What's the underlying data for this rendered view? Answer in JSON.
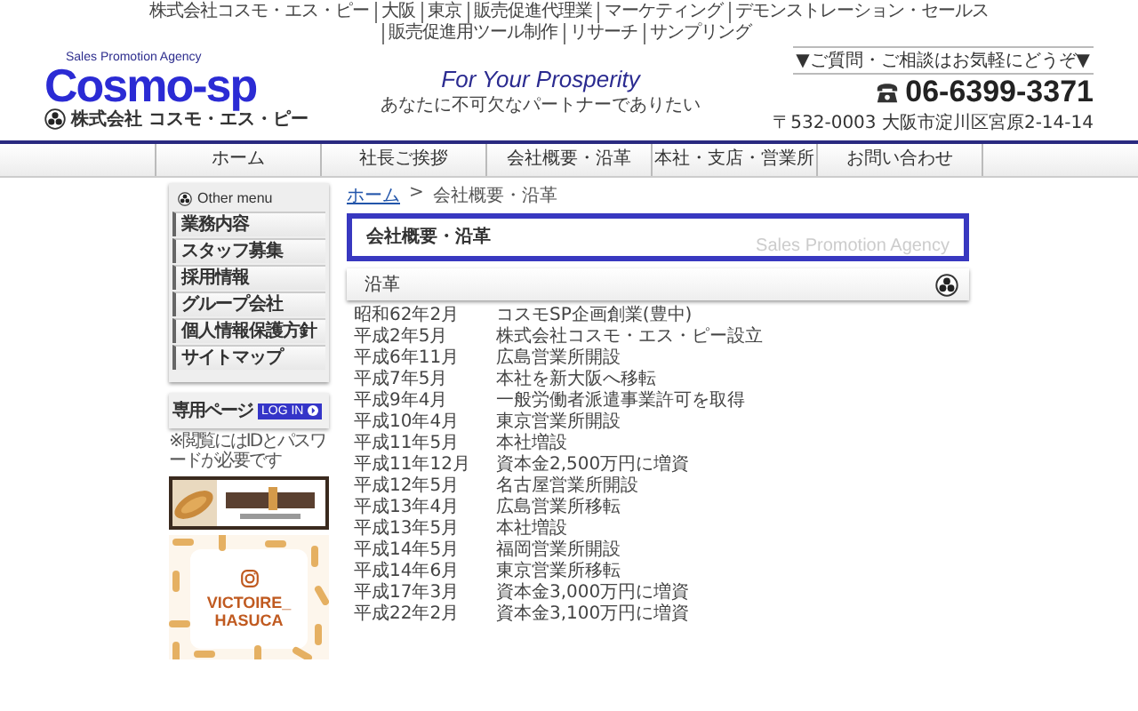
{
  "top_links": [
    "株式会社コスモ・エス・ピー",
    "大阪",
    "東京",
    "販売促進代理業",
    "マーケティング",
    "デモンストレーション・セールス",
    "販売促進用ツール制作",
    "リサーチ",
    "サンプリング"
  ],
  "logo": {
    "tagline": "Sales Promotion Agency",
    "name": "Cosmo-sp",
    "company": "株式会社 コスモ・エス・ピー"
  },
  "slogan": {
    "title": "For Your Prosperity",
    "subtitle": "あなたに不可欠なパートナーでありたい"
  },
  "contact": {
    "note": "▼ご質問・ご相談はお気軽にどうぞ▼",
    "phone": "06-6399-3371",
    "address": "〒532-0003 大阪市淀川区宮原2-14-14"
  },
  "nav": [
    "ホーム",
    "社長ご挨拶",
    "会社概要・沿革",
    "本社・支店・営業所",
    "お問い合わせ"
  ],
  "breadcrumb": {
    "home": "ホーム",
    "separator": ">",
    "current": "会社概要・沿革"
  },
  "sidebar": {
    "heading": "Other menu",
    "items": [
      "業務内容",
      "スタッフ募集",
      "採用情報",
      "グループ会社",
      "個人情報保護方針",
      "サイトマップ"
    ],
    "members": {
      "title": "専用ページ",
      "button": "LOG IN",
      "note": "※閲覧にはIDとパスワードが必要です"
    },
    "instagram": {
      "label": "VICTOIRE_ HASUCA"
    }
  },
  "page_title": {
    "text": "会社概要・沿革",
    "watermark": "Sales Promotion Agency"
  },
  "history": {
    "heading": "沿革",
    "rows": [
      {
        "date": "昭和62年2月",
        "event": "コスモSP企画創業(豊中)"
      },
      {
        "date": "平成2年5月",
        "event": "株式会社コスモ・エス・ピー設立"
      },
      {
        "date": "平成6年11月",
        "event": "広島営業所開設"
      },
      {
        "date": "平成7年5月",
        "event": "本社を新大阪へ移転"
      },
      {
        "date": "平成9年4月",
        "event": "一般労働者派遣事業許可を取得"
      },
      {
        "date": "平成10年4月",
        "event": "東京営業所開設"
      },
      {
        "date": "平成11年5月",
        "event": "本社増設"
      },
      {
        "date": "平成11年12月",
        "event": "資本金2,500万円に増資"
      },
      {
        "date": "平成12年5月",
        "event": "名古屋営業所開設"
      },
      {
        "date": "平成13年4月",
        "event": "広島営業所移転"
      },
      {
        "date": "平成13年5月",
        "event": "本社増設"
      },
      {
        "date": "平成14年5月",
        "event": "福岡営業所開設"
      },
      {
        "date": "平成14年6月",
        "event": "東京営業所移転"
      },
      {
        "date": "平成17年3月",
        "event": "資本金3,000万円に増資"
      },
      {
        "date": "平成22年2月",
        "event": "資本金3,100万円に増資"
      }
    ]
  }
}
